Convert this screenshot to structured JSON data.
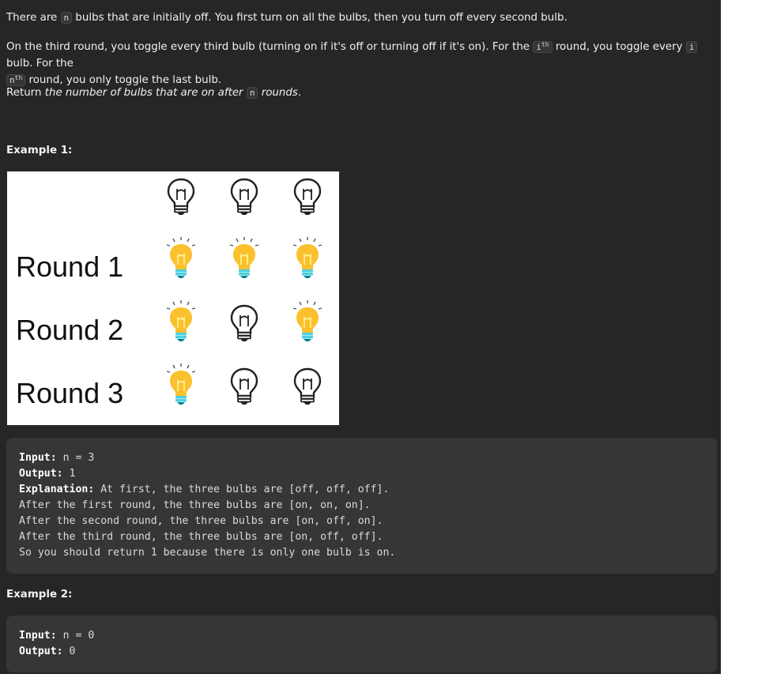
{
  "description": {
    "p1": {
      "a": "There are ",
      "code": "n",
      "b": " bulbs that are initially off. You first turn on all the bulbs, then you turn off every second bulb."
    },
    "p2": {
      "a": "On the third round, you toggle every third bulb (turning on if it's off or turning off if it's on). For the ",
      "code1": "i",
      "code1_sup": "th",
      "b": " round, you toggle every ",
      "code2": "i",
      "c": " bulb. For the",
      "code3": "n",
      "code3_sup": "th",
      "d": " round, you only toggle the last bulb."
    },
    "p3": {
      "a": "Return ",
      "em1": "the number of bulbs that are on after ",
      "code": "n",
      "em2": " rounds",
      "b": "."
    }
  },
  "example1": {
    "title": "Example 1:",
    "figure": {
      "rounds": [
        "Round 1",
        "Round 2",
        "Round 3"
      ],
      "states": [
        [
          "off",
          "off",
          "off"
        ],
        [
          "on",
          "on",
          "on"
        ],
        [
          "on",
          "off",
          "on"
        ],
        [
          "on",
          "off",
          "off"
        ]
      ]
    },
    "input_label": "Input:",
    "input_value": " n = 3",
    "output_label": "Output:",
    "output_value": " 1",
    "explanation_label": "Explanation:",
    "explanation_lines": [
      " At first, the three bulbs are [off, off, off].",
      "After the first round, the three bulbs are [on, on, on].",
      "After the second round, the three bulbs are [on, off, on].",
      "After the third round, the three bulbs are [on, off, off].",
      "So you should return 1 because there is only one bulb is on."
    ]
  },
  "example2": {
    "title": "Example 2:",
    "input_label": "Input:",
    "input_value": " n = 0",
    "output_label": "Output:",
    "output_value": " 0"
  },
  "colors": {
    "panel": "#262626",
    "codebox": "#363636",
    "bulb_on": "#fbc02d",
    "bulb_base": "#4dd0e1"
  }
}
